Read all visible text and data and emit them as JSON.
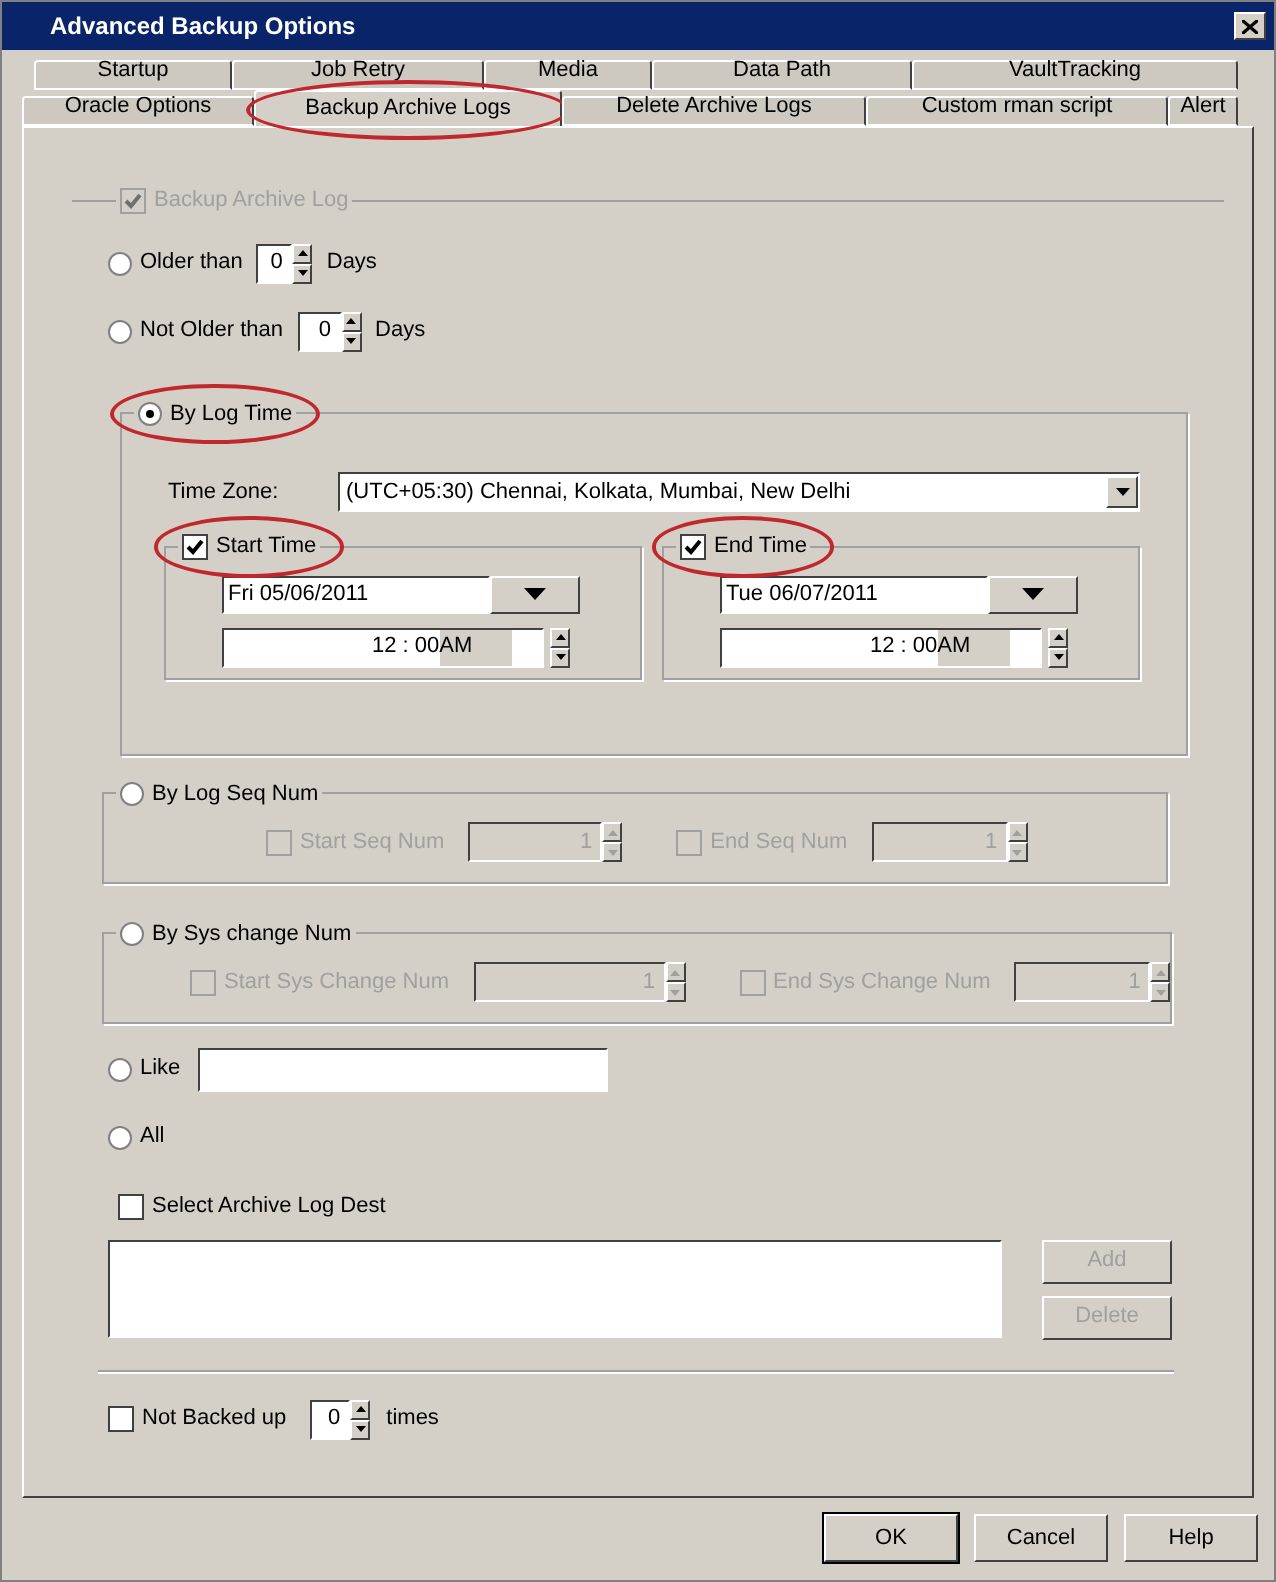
{
  "window": {
    "title": "Advanced Backup Options"
  },
  "tab_rows": [
    {
      "tabs": [
        {
          "label": "Startup",
          "selected": false
        },
        {
          "label": "Job Retry",
          "selected": false
        },
        {
          "label": "Media",
          "selected": false
        },
        {
          "label": "Data Path",
          "selected": false
        },
        {
          "label": "VaultTracking",
          "selected": false
        }
      ]
    },
    {
      "tabs": [
        {
          "label": "Oracle Options",
          "selected": false
        },
        {
          "label": "Backup Archive Logs",
          "selected": true,
          "highlighted": true
        },
        {
          "label": "Delete Archive Logs",
          "selected": false
        },
        {
          "label": "Custom rman script",
          "selected": false
        },
        {
          "label": "Alert",
          "selected": false
        }
      ]
    }
  ],
  "group": {
    "label": "Backup Archive Log",
    "checked": true,
    "disabled": true
  },
  "older_than": {
    "label": "Older than",
    "selected": false,
    "value": "0",
    "unit": "Days"
  },
  "not_older_than": {
    "label": "Not Older than",
    "selected": false,
    "value": "0",
    "unit": "Days"
  },
  "by_log_time": {
    "label": "By Log Time",
    "selected": true,
    "highlighted": true,
    "time_zone_label": "Time Zone:",
    "time_zone": "(UTC+05:30) Chennai, Kolkata, Mumbai, New Delhi",
    "start": {
      "label": "Start Time",
      "checked": true,
      "highlighted": true,
      "date": "Fri 05/06/2011",
      "time": "12 : 00",
      "period": "AM"
    },
    "end": {
      "label": "End Time",
      "checked": true,
      "highlighted": true,
      "date": "Tue 06/07/2011",
      "time": "12 : 00",
      "period": "AM"
    }
  },
  "by_log_seq_num": {
    "label": "By Log Seq Num",
    "selected": false,
    "start": {
      "label": "Start Seq Num",
      "checked": false,
      "disabled": true,
      "value": "1"
    },
    "end": {
      "label": "End Seq Num",
      "checked": false,
      "disabled": true,
      "value": "1"
    }
  },
  "by_sys_change_num": {
    "label": "By Sys change Num",
    "selected": false,
    "start": {
      "label": "Start Sys Change Num",
      "checked": false,
      "disabled": true,
      "value": "1"
    },
    "end": {
      "label": "End Sys Change Num",
      "checked": false,
      "disabled": true,
      "value": "1"
    }
  },
  "like": {
    "label": "Like",
    "selected": false
  },
  "all": {
    "label": "All",
    "selected": false
  },
  "archive_log_dest": {
    "label": "Select Archive Log Dest",
    "checked": false
  },
  "dest_buttons": [
    {
      "label": "Add",
      "disabled": true
    },
    {
      "label": "Delete",
      "disabled": true
    }
  ],
  "not_backed_up": {
    "label": "Not Backed up",
    "checked": false,
    "value": "0",
    "unit": "times"
  },
  "buttons": [
    {
      "label": "OK"
    },
    {
      "label": "Cancel"
    },
    {
      "label": "Help"
    }
  ]
}
